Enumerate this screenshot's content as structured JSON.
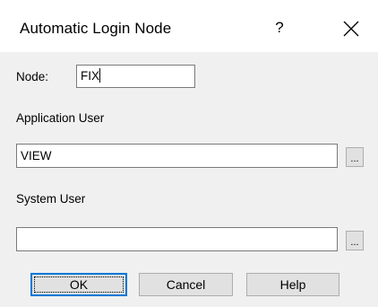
{
  "dialog": {
    "title": "Automatic Login Node",
    "help_glyph": "?",
    "close_icon": "close-icon"
  },
  "node": {
    "label": "Node:",
    "value": "FIX"
  },
  "application_user": {
    "label": "Application User",
    "value": "VIEW",
    "browse_label": "..."
  },
  "system_user": {
    "label": "System User",
    "value": "",
    "browse_label": "..."
  },
  "buttons": {
    "ok": "OK",
    "cancel": "Cancel",
    "help": "Help"
  },
  "colors": {
    "focus_border": "#0078d7",
    "dialog_bg": "#f0f0f0",
    "titlebar_bg": "#ffffff"
  }
}
